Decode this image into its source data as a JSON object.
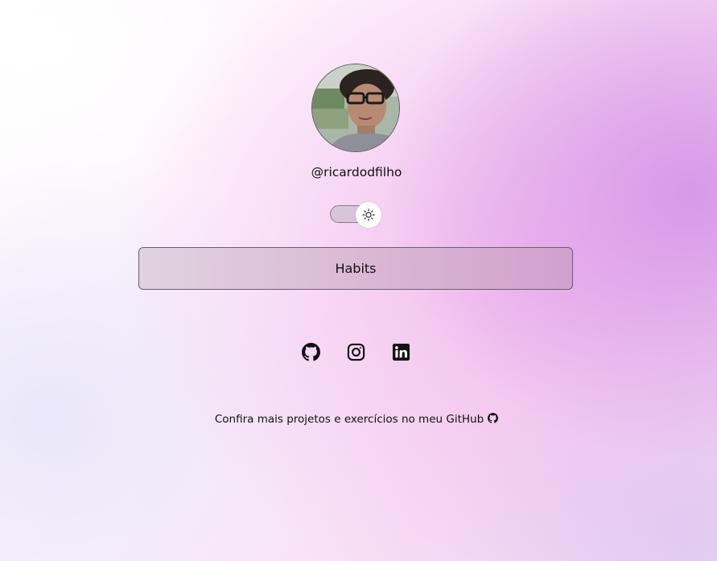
{
  "profile": {
    "username": "@ricardodfilho",
    "avatar_icon": "profile-photo"
  },
  "theme_toggle": {
    "icon": "sun-icon",
    "state": "light"
  },
  "links": [
    {
      "label": "Habits"
    }
  ],
  "social": [
    {
      "icon": "github-icon"
    },
    {
      "icon": "instagram-icon"
    },
    {
      "icon": "linkedin-icon"
    }
  ],
  "footer": {
    "text": "Confira mais projetos e exercícios no meu GitHub",
    "icon": "github-icon"
  },
  "colors": {
    "accent_pink": "#f0b2ec",
    "accent_purple": "#d696e8",
    "text": "#111111"
  }
}
